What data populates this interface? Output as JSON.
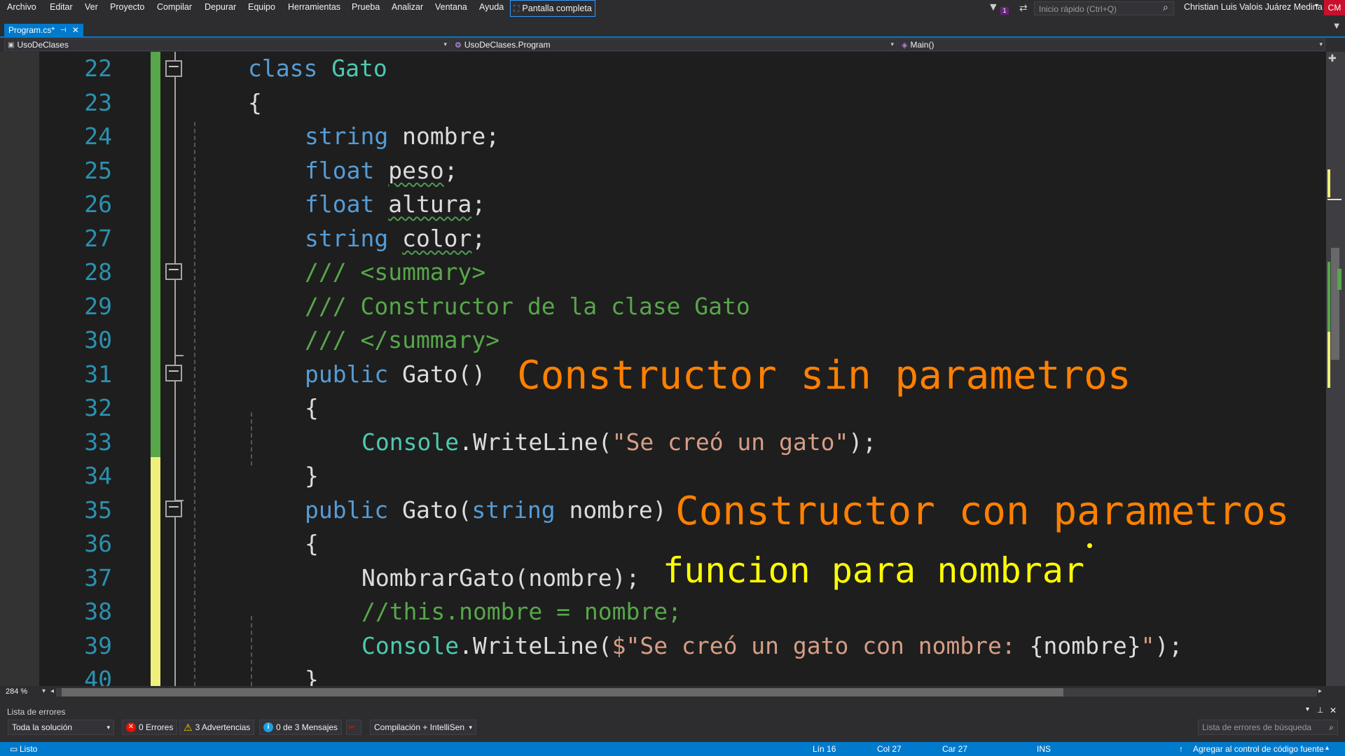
{
  "menu": {
    "items": [
      "Archivo",
      "Editar",
      "Ver",
      "Proyecto",
      "Compilar",
      "Depurar",
      "Equipo",
      "Herramientas",
      "Prueba",
      "Analizar",
      "Ventana",
      "Ayuda"
    ],
    "fullscreen_label": "Pantalla completa",
    "notification_count": "1",
    "quick_launch_placeholder": "Inicio rápido (Ctrl+Q)",
    "user_name": "Christian Luis Valois Juárez Medina",
    "avatar_initials": "CM"
  },
  "tabs": [
    {
      "label": "Program.cs*",
      "active": true
    }
  ],
  "navbar": {
    "project": "UsoDeClases",
    "type": "UsoDeClases.Program",
    "member": "Main()"
  },
  "editor": {
    "line_numbers": [
      "22",
      "23",
      "24",
      "25",
      "26",
      "27",
      "28",
      "29",
      "30",
      "31",
      "32",
      "33",
      "34",
      "35",
      "36",
      "37",
      "38",
      "39",
      "40"
    ],
    "lines": [
      [
        {
          "t": "class ",
          "c": "kw"
        },
        {
          "t": "Gato",
          "c": "typ"
        }
      ],
      [
        {
          "t": "{",
          "c": "pl"
        }
      ],
      [
        {
          "t": "string ",
          "c": "kw"
        },
        {
          "t": "nombre;",
          "c": "pl"
        }
      ],
      [
        {
          "t": "float ",
          "c": "kw"
        },
        {
          "t": "peso",
          "c": "pl",
          "sq": true
        },
        {
          "t": ";",
          "c": "pl"
        }
      ],
      [
        {
          "t": "float ",
          "c": "kw"
        },
        {
          "t": "altura",
          "c": "pl",
          "sq": true
        },
        {
          "t": ";",
          "c": "pl"
        }
      ],
      [
        {
          "t": "string ",
          "c": "kw"
        },
        {
          "t": "color",
          "c": "pl",
          "sq": true
        },
        {
          "t": ";",
          "c": "pl"
        }
      ],
      [
        {
          "t": "/// <summary>",
          "c": "cm"
        }
      ],
      [
        {
          "t": "/// Constructor de la clase Gato",
          "c": "cm"
        }
      ],
      [
        {
          "t": "/// </summary>",
          "c": "cm"
        }
      ],
      [
        {
          "t": "public ",
          "c": "kw"
        },
        {
          "t": "Gato()",
          "c": "pl"
        }
      ],
      [
        {
          "t": "{",
          "c": "pl"
        }
      ],
      [
        {
          "t": "Console",
          "c": "typ"
        },
        {
          "t": ".WriteLine(",
          "c": "pl"
        },
        {
          "t": "\"Se creó un gato\"",
          "c": "str"
        },
        {
          "t": ");",
          "c": "pl"
        }
      ],
      [
        {
          "t": "}",
          "c": "pl"
        }
      ],
      [
        {
          "t": "public ",
          "c": "kw"
        },
        {
          "t": "Gato(",
          "c": "pl"
        },
        {
          "t": "string ",
          "c": "kw"
        },
        {
          "t": "nombre)",
          "c": "pl"
        }
      ],
      [
        {
          "t": "{",
          "c": "pl"
        }
      ],
      [
        {
          "t": "NombrarGato(nombre);",
          "c": "pl"
        }
      ],
      [
        {
          "t": "//this.nombre = nombre;",
          "c": "cm"
        }
      ],
      [
        {
          "t": "Console",
          "c": "typ"
        },
        {
          "t": ".WriteLine(",
          "c": "pl"
        },
        {
          "t": "$\"Se creó un gato con nombre: ",
          "c": "str"
        },
        {
          "t": "{nombre}",
          "c": "pl"
        },
        {
          "t": "\"",
          "c": "str"
        },
        {
          "t": ");",
          "c": "pl"
        }
      ],
      [
        {
          "t": "}",
          "c": "pl"
        }
      ]
    ],
    "annotations": [
      {
        "text": "Constructor sin parametros",
        "color": "#ff8000"
      },
      {
        "text": "Constructor con parametros",
        "color": "#ff8000"
      },
      {
        "text": "funcion para nombrar",
        "color": "#ffff00"
      }
    ]
  },
  "zoom_level": "284 %",
  "error_list": {
    "title": "Lista de errores",
    "scope": "Toda la solución",
    "errors": "0 Errores",
    "warnings": "3 Advertencias",
    "messages": "0 de 3 Mensajes",
    "build_filter": "Compilación + IntelliSen",
    "search_placeholder": "Lista de errores de búsqueda"
  },
  "status": {
    "state": "Listo",
    "line": "Lín 16",
    "col": "Col 27",
    "char": "Car 27",
    "mode": "INS",
    "source_control": "Agregar al control de código fuente"
  },
  "colors": {
    "accent": "#007acc",
    "keyword": "#569cd6",
    "type": "#4ec9b0",
    "comment": "#57a64a",
    "string": "#d69d85",
    "line_number": "#2b91af"
  },
  "icons": [
    "filter-icon",
    "feedback-icon",
    "search-icon",
    "pin-icon",
    "close-icon",
    "split-icon",
    "error-icon",
    "warning-icon",
    "info-icon",
    "source-control-icon"
  ]
}
